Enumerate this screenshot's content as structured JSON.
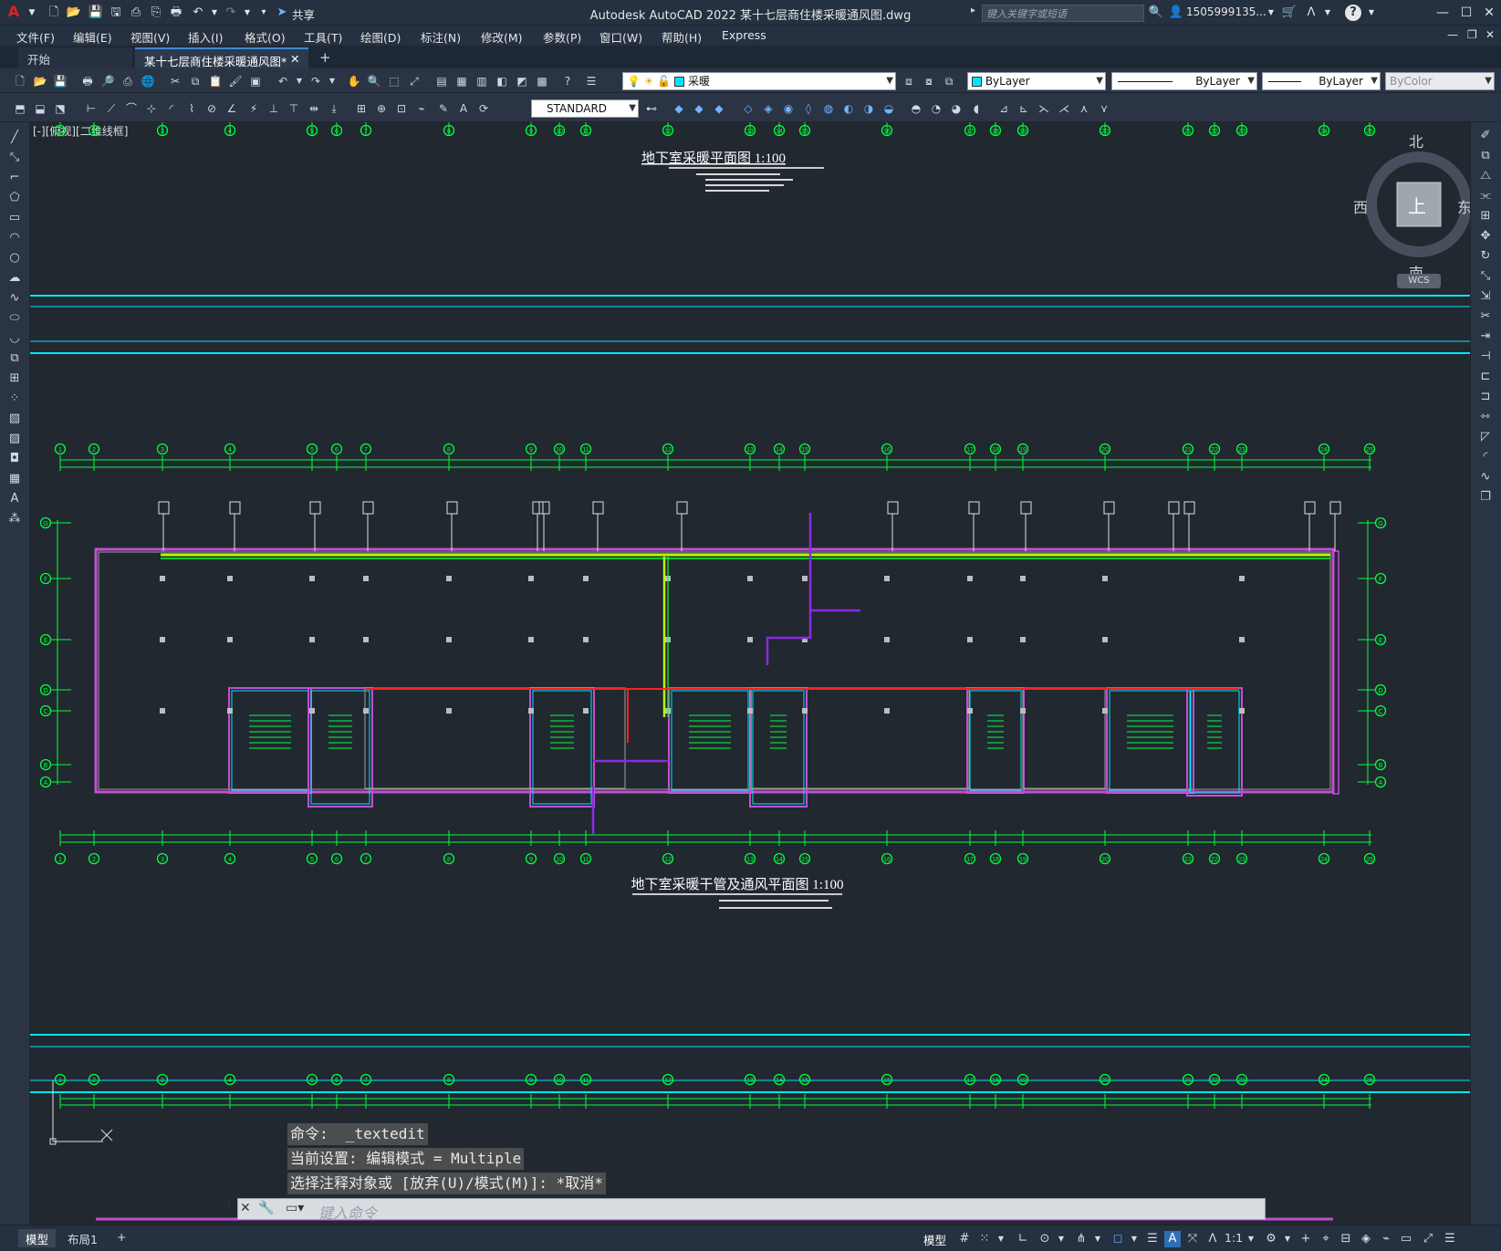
{
  "app": {
    "title": "Autodesk AutoCAD 2022    某十七层商住楼采暖通风图.dwg",
    "logo": "A",
    "share_label": "共享",
    "search_placeholder": "键入关键字或短语",
    "user_label": "1505999135...",
    "help_icon": "?"
  },
  "menu": [
    "文件(F)",
    "编辑(E)",
    "视图(V)",
    "插入(I)",
    "格式(O)",
    "工具(T)",
    "绘图(D)",
    "标注(N)",
    "修改(M)",
    "参数(P)",
    "窗口(W)",
    "帮助(H)",
    "Express"
  ],
  "tabs": {
    "start": "开始",
    "active": "某十七层商住楼采暖通风图*"
  },
  "toolbar": {
    "layer_name": "采暖",
    "color": "ByLayer",
    "linetype": "ByLayer",
    "lineweight": "ByLayer",
    "plotstyle": "ByColor",
    "text_style": "STANDARD"
  },
  "viewport_label": "[-][俯视][二维线框]",
  "viewcube": {
    "north": "北",
    "south": "南",
    "east": "东",
    "west": "西",
    "top": "上",
    "wcs": "WCS"
  },
  "drawing": {
    "title1": "地下室采暖平面图  1:100",
    "title2": "地下室采暖干管及通风平面图  1:100",
    "grid_top": [
      "1",
      "2",
      "3",
      "4",
      "5",
      "6",
      "7",
      "8",
      "9",
      "10",
      "11",
      "12",
      "13",
      "14",
      "15",
      "16",
      "17",
      "18",
      "19",
      "20",
      "21",
      "22",
      "23",
      "24",
      "25"
    ],
    "grid_left": [
      "G",
      "F",
      "E",
      "D",
      "C",
      "B",
      "A"
    ],
    "grid_right": [
      "G",
      "F",
      "E",
      "D",
      "C",
      "B",
      "A"
    ]
  },
  "command": {
    "line1": "命令:  _textedit",
    "line2": "当前设置: 编辑模式 = Multiple",
    "line3": "选择注释对象或 [放弃(U)/模式(M)]: *取消*",
    "input_placeholder": "键入命令"
  },
  "status": {
    "model_tab": "模型",
    "layout_tab": "布局1",
    "add_tab": "+",
    "model_button": "模型",
    "scale": "1:1"
  },
  "colors": {
    "accent": "#3d8ad6",
    "canvas": "#212830",
    "cyan": "#00e5ff",
    "green": "#00ff3c",
    "magenta": "#c44dd4",
    "red": "#ff2020"
  }
}
